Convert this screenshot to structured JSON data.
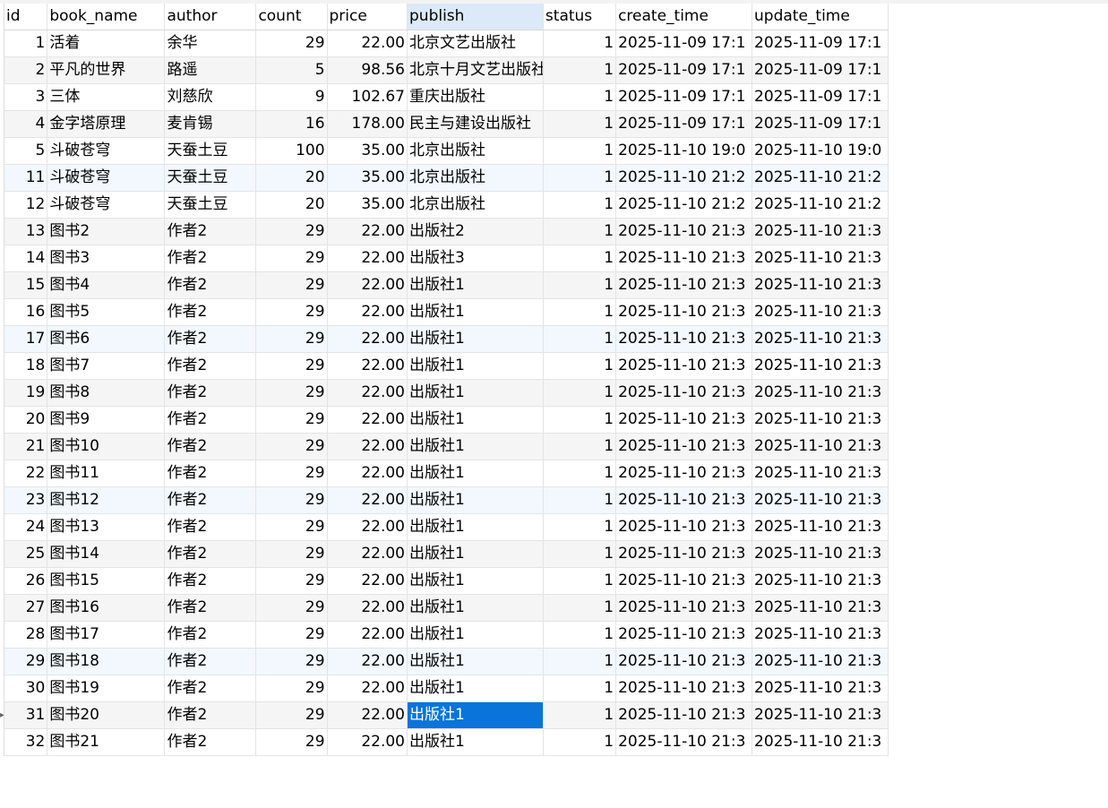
{
  "columns": [
    {
      "key": "id",
      "label": "id"
    },
    {
      "key": "book_name",
      "label": "book_name"
    },
    {
      "key": "author",
      "label": "author"
    },
    {
      "key": "count",
      "label": "count"
    },
    {
      "key": "price",
      "label": "price"
    },
    {
      "key": "publish",
      "label": "publish"
    },
    {
      "key": "status",
      "label": "status"
    },
    {
      "key": "create_time",
      "label": "create_time"
    },
    {
      "key": "update_time",
      "label": "update_time"
    }
  ],
  "active_column": "publish",
  "selected_row_index": 25,
  "colors": {
    "selection": "#0a74da",
    "header_active": "#dbe9f8",
    "row_alt": "#f5f5f5"
  },
  "rows": [
    {
      "id": "1",
      "book_name": "活着",
      "author": "余华",
      "count": "29",
      "price": "22.00",
      "publish": "北京文艺出版社",
      "status": "1",
      "create_time": "2025-11-09 17:1",
      "update_time": "2025-11-09 17:1"
    },
    {
      "id": "2",
      "book_name": "平凡的世界",
      "author": "路遥",
      "count": "5",
      "price": "98.56",
      "publish": "北京十月文艺出版社",
      "status": "1",
      "create_time": "2025-11-09 17:1",
      "update_time": "2025-11-09 17:1"
    },
    {
      "id": "3",
      "book_name": "三体",
      "author": "刘慈欣",
      "count": "9",
      "price": "102.67",
      "publish": "重庆出版社",
      "status": "1",
      "create_time": "2025-11-09 17:1",
      "update_time": "2025-11-09 17:1"
    },
    {
      "id": "4",
      "book_name": "金字塔原理",
      "author": "麦肯锡",
      "count": "16",
      "price": "178.00",
      "publish": "民主与建设出版社",
      "status": "1",
      "create_time": "2025-11-09 17:1",
      "update_time": "2025-11-09 17:1"
    },
    {
      "id": "5",
      "book_name": "斗破苍穹",
      "author": "天蚕土豆",
      "count": "100",
      "price": "35.00",
      "publish": "北京出版社",
      "status": "1",
      "create_time": "2025-11-10 19:0",
      "update_time": "2025-11-10 19:0"
    },
    {
      "id": "11",
      "book_name": "斗破苍穹",
      "author": "天蚕土豆",
      "count": "20",
      "price": "35.00",
      "publish": "北京出版社",
      "status": "1",
      "create_time": "2025-11-10 21:2",
      "update_time": "2025-11-10 21:2"
    },
    {
      "id": "12",
      "book_name": "斗破苍穹",
      "author": "天蚕土豆",
      "count": "20",
      "price": "35.00",
      "publish": "北京出版社",
      "status": "1",
      "create_time": "2025-11-10 21:2",
      "update_time": "2025-11-10 21:2"
    },
    {
      "id": "13",
      "book_name": "图书2",
      "author": "作者2",
      "count": "29",
      "price": "22.00",
      "publish": "出版社2",
      "status": "1",
      "create_time": "2025-11-10 21:3",
      "update_time": "2025-11-10 21:3"
    },
    {
      "id": "14",
      "book_name": "图书3",
      "author": "作者2",
      "count": "29",
      "price": "22.00",
      "publish": "出版社3",
      "status": "1",
      "create_time": "2025-11-10 21:3",
      "update_time": "2025-11-10 21:3"
    },
    {
      "id": "15",
      "book_name": "图书4",
      "author": "作者2",
      "count": "29",
      "price": "22.00",
      "publish": "出版社1",
      "status": "1",
      "create_time": "2025-11-10 21:3",
      "update_time": "2025-11-10 21:3"
    },
    {
      "id": "16",
      "book_name": "图书5",
      "author": "作者2",
      "count": "29",
      "price": "22.00",
      "publish": "出版社1",
      "status": "1",
      "create_time": "2025-11-10 21:3",
      "update_time": "2025-11-10 21:3"
    },
    {
      "id": "17",
      "book_name": "图书6",
      "author": "作者2",
      "count": "29",
      "price": "22.00",
      "publish": "出版社1",
      "status": "1",
      "create_time": "2025-11-10 21:3",
      "update_time": "2025-11-10 21:3"
    },
    {
      "id": "18",
      "book_name": "图书7",
      "author": "作者2",
      "count": "29",
      "price": "22.00",
      "publish": "出版社1",
      "status": "1",
      "create_time": "2025-11-10 21:3",
      "update_time": "2025-11-10 21:3"
    },
    {
      "id": "19",
      "book_name": "图书8",
      "author": "作者2",
      "count": "29",
      "price": "22.00",
      "publish": "出版社1",
      "status": "1",
      "create_time": "2025-11-10 21:3",
      "update_time": "2025-11-10 21:3"
    },
    {
      "id": "20",
      "book_name": "图书9",
      "author": "作者2",
      "count": "29",
      "price": "22.00",
      "publish": "出版社1",
      "status": "1",
      "create_time": "2025-11-10 21:3",
      "update_time": "2025-11-10 21:3"
    },
    {
      "id": "21",
      "book_name": "图书10",
      "author": "作者2",
      "count": "29",
      "price": "22.00",
      "publish": "出版社1",
      "status": "1",
      "create_time": "2025-11-10 21:3",
      "update_time": "2025-11-10 21:3"
    },
    {
      "id": "22",
      "book_name": "图书11",
      "author": "作者2",
      "count": "29",
      "price": "22.00",
      "publish": "出版社1",
      "status": "1",
      "create_time": "2025-11-10 21:3",
      "update_time": "2025-11-10 21:3"
    },
    {
      "id": "23",
      "book_name": "图书12",
      "author": "作者2",
      "count": "29",
      "price": "22.00",
      "publish": "出版社1",
      "status": "1",
      "create_time": "2025-11-10 21:3",
      "update_time": "2025-11-10 21:3"
    },
    {
      "id": "24",
      "book_name": "图书13",
      "author": "作者2",
      "count": "29",
      "price": "22.00",
      "publish": "出版社1",
      "status": "1",
      "create_time": "2025-11-10 21:3",
      "update_time": "2025-11-10 21:3"
    },
    {
      "id": "25",
      "book_name": "图书14",
      "author": "作者2",
      "count": "29",
      "price": "22.00",
      "publish": "出版社1",
      "status": "1",
      "create_time": "2025-11-10 21:3",
      "update_time": "2025-11-10 21:3"
    },
    {
      "id": "26",
      "book_name": "图书15",
      "author": "作者2",
      "count": "29",
      "price": "22.00",
      "publish": "出版社1",
      "status": "1",
      "create_time": "2025-11-10 21:3",
      "update_time": "2025-11-10 21:3"
    },
    {
      "id": "27",
      "book_name": "图书16",
      "author": "作者2",
      "count": "29",
      "price": "22.00",
      "publish": "出版社1",
      "status": "1",
      "create_time": "2025-11-10 21:3",
      "update_time": "2025-11-10 21:3"
    },
    {
      "id": "28",
      "book_name": "图书17",
      "author": "作者2",
      "count": "29",
      "price": "22.00",
      "publish": "出版社1",
      "status": "1",
      "create_time": "2025-11-10 21:3",
      "update_time": "2025-11-10 21:3"
    },
    {
      "id": "29",
      "book_name": "图书18",
      "author": "作者2",
      "count": "29",
      "price": "22.00",
      "publish": "出版社1",
      "status": "1",
      "create_time": "2025-11-10 21:3",
      "update_time": "2025-11-10 21:3"
    },
    {
      "id": "30",
      "book_name": "图书19",
      "author": "作者2",
      "count": "29",
      "price": "22.00",
      "publish": "出版社1",
      "status": "1",
      "create_time": "2025-11-10 21:3",
      "update_time": "2025-11-10 21:3"
    },
    {
      "id": "31",
      "book_name": "图书20",
      "author": "作者2",
      "count": "29",
      "price": "22.00",
      "publish": "出版社1",
      "status": "1",
      "create_time": "2025-11-10 21:3",
      "update_time": "2025-11-10 21:3"
    },
    {
      "id": "32",
      "book_name": "图书21",
      "author": "作者2",
      "count": "29",
      "price": "22.00",
      "publish": "出版社1",
      "status": "1",
      "create_time": "2025-11-10 21:3",
      "update_time": "2025-11-10 21:3"
    }
  ]
}
